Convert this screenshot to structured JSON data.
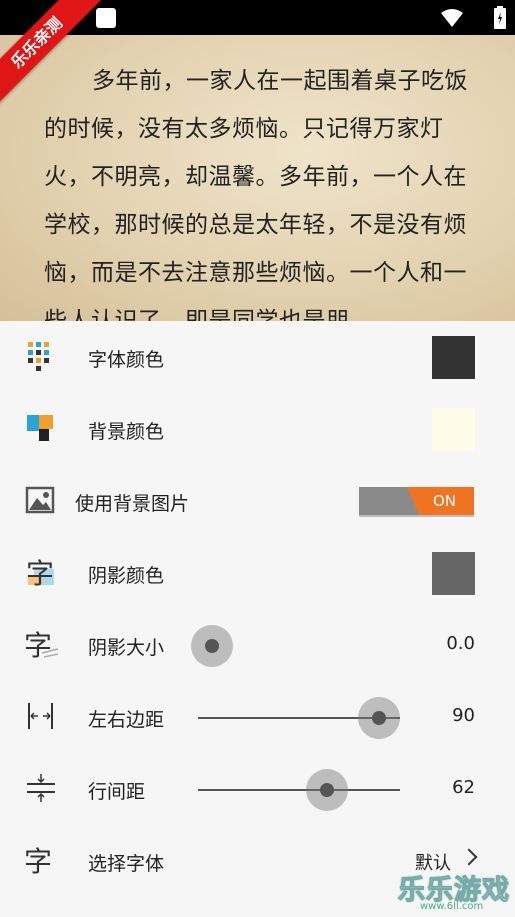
{
  "status_bar": {},
  "ribbon": {
    "text": "乐乐亲测"
  },
  "reader": {
    "text": "多年前，一家人在一起围着桌子吃饭的时候，没有太多烦恼。只记得万家灯火，不明亮，却温馨。多年前，一个人在学校，那时候的总是太年轻，不是没有烦恼，而是不去注意那些烦恼。一个人和一些人认识了，即是同学也是朋"
  },
  "settings": {
    "font_color": {
      "label": "字体颜色",
      "swatch": "#333333"
    },
    "bg_color": {
      "label": "背景颜色",
      "swatch": "#fffdea"
    },
    "bg_image": {
      "label": "使用背景图片",
      "toggle_text": "ON",
      "accent": "#f07322"
    },
    "shadow_color": {
      "label": "阴影颜色",
      "swatch": "#666666"
    },
    "shadow_size": {
      "label": "阴影大小",
      "value": "0.0",
      "fraction": 0.0
    },
    "margin": {
      "label": "左右边距",
      "value": "90",
      "fraction": 0.9
    },
    "line_spacing": {
      "label": "行间距",
      "value": "62",
      "fraction": 0.62
    },
    "font_face": {
      "label": "选择字体",
      "value": "默认"
    }
  },
  "watermark": {
    "main": "乐乐游戏",
    "url": "www.6ll.com"
  }
}
